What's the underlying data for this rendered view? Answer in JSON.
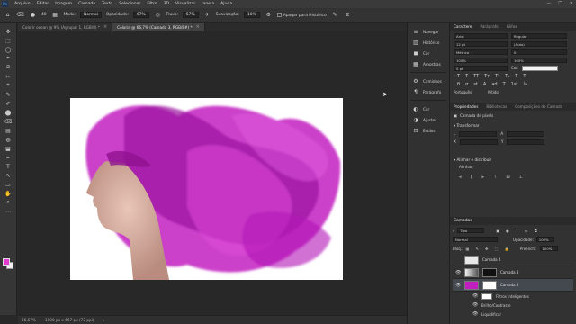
{
  "menu": {
    "logo": "Ps",
    "items": [
      "Arquivo",
      "Editar",
      "Imagem",
      "Camada",
      "Texto",
      "Selecionar",
      "Filtro",
      "3D",
      "Visualizar",
      "Janela",
      "Ajuda"
    ],
    "window_controls": [
      "—",
      "❐",
      "✕"
    ]
  },
  "options": {
    "mode_label": "Modo:",
    "mode_value": "Normal",
    "opacity_label": "Opacidade:",
    "opacity_value": "67%",
    "flow_label": "Fluxo:",
    "flow_value": "57%",
    "smoothing_label": "Suavização:",
    "smoothing_value": "10%",
    "history_label": "Apagar para Histórico",
    "brush_size": "40"
  },
  "tabs": [
    {
      "label": "Colorir ocean @ 9% (Agrupar 1, RGB/8) *"
    },
    {
      "label": "Coloria @ 66,7% (Camada 3, RGB/8#) *"
    }
  ],
  "tools": [
    "✥",
    "⬚",
    "◯",
    "⌖",
    "⧄",
    "✂",
    "⌗",
    "✎",
    "✐",
    "⬤",
    "⌫",
    "▤",
    "◍",
    "⬓",
    "✒",
    "T",
    "↖",
    "▭",
    "✋",
    "⌕",
    "⋯"
  ],
  "status": {
    "zoom": "66,67%",
    "info": "1000 px x 667 px (72 ppi)"
  },
  "mid_panel": {
    "group1": [
      {
        "icon": "≡",
        "label": "Navegar"
      },
      {
        "icon": "▥",
        "label": "Histórico"
      },
      {
        "icon": "◼",
        "label": "Cor"
      },
      {
        "icon": "▦",
        "label": "Amostras"
      }
    ],
    "group2": [
      {
        "icon": "⚙",
        "label": "Caminhos"
      },
      {
        "icon": "¶",
        "label": "Parágrafo"
      }
    ],
    "group3": [
      {
        "icon": "◐",
        "label": "Cor"
      },
      {
        "icon": "◑",
        "label": "Ajustes"
      },
      {
        "icon": "⊡",
        "label": "Estilos"
      }
    ]
  },
  "character": {
    "tabs": [
      "Caractere",
      "Parágrafo",
      "Glifos"
    ],
    "font_family": "Arial",
    "font_style": "Regular",
    "size": "12 pt",
    "leading": "(Auto)",
    "tracking": "Métrica",
    "kerning": "0",
    "vscale": "100%",
    "hscale": "100%",
    "baseline": "0 pt",
    "color_label": "Cor:",
    "language": "Português",
    "antialias": "Nítido",
    "format_buttons": [
      "T",
      "T",
      "TT",
      "Tт",
      "T¹",
      "T₁",
      "T",
      "T̶"
    ],
    "opentype_buttons": [
      "ﬁ",
      "σ",
      "st",
      "A",
      "ad",
      "T",
      "1st",
      "½"
    ]
  },
  "properties": {
    "tabs": [
      "Propriedades",
      "Bibliotecas",
      "Composições de Camada"
    ],
    "layer_type": "Camada de pixels",
    "transform_label": "Transformar",
    "transform_fields": [
      "L",
      "A",
      "X",
      "Y"
    ],
    "align_label": "Alinhar e distribuir",
    "align_sub": "Alinhar:"
  },
  "layers": {
    "title": "Camadas",
    "kind_label": "Tipo",
    "blend_mode": "Normal",
    "opacity_label": "Opacidade:",
    "opacity_value": "100%",
    "lock_label": "Bloq.:",
    "fill_label": "Preench.:",
    "fill_value": "100%",
    "rows": [
      {
        "name": "Camada 4",
        "eye": "",
        "thumb": "#e8e8e8",
        "selected": false
      },
      {
        "name": "Camada 3",
        "eye": "👁",
        "thumb": "#777777",
        "selected": false
      },
      {
        "name": "Camada 2",
        "eye": "👁",
        "thumb": "#c21fc0",
        "selected": true
      }
    ],
    "sub_rows": [
      {
        "name": "Filtros Inteligentes"
      },
      {
        "name": "Brilho/Contraste"
      },
      {
        "name": "Liquidificar"
      }
    ]
  },
  "colors": {
    "foreground": "#e23bd0",
    "background": "#f2f2f2",
    "ink": "#c21fc0"
  }
}
